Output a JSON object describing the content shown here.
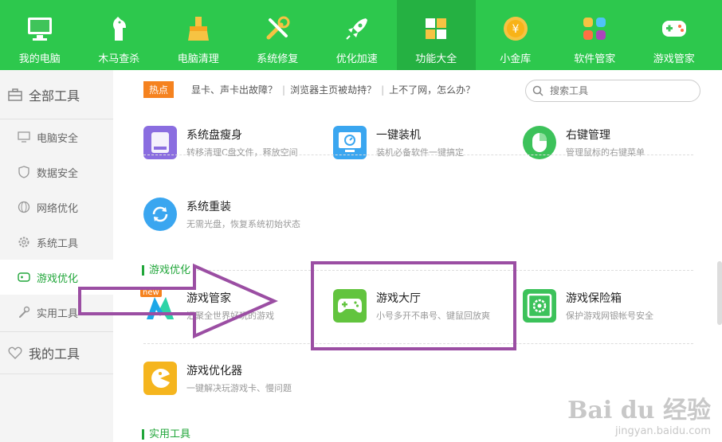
{
  "nav": {
    "items": [
      {
        "label": "我的电脑",
        "icon": "monitor-icon"
      },
      {
        "label": "木马查杀",
        "icon": "trojan-horse-icon"
      },
      {
        "label": "电脑清理",
        "icon": "broom-icon"
      },
      {
        "label": "系统修复",
        "icon": "wrench-icon"
      },
      {
        "label": "优化加速",
        "icon": "rocket-icon"
      },
      {
        "label": "功能大全",
        "icon": "grid-icon",
        "active": true
      },
      {
        "label": "小金库",
        "icon": "coin-icon"
      },
      {
        "label": "软件管家",
        "icon": "apps-icon"
      },
      {
        "label": "游戏管家",
        "icon": "gamepad-icon"
      }
    ]
  },
  "sidebar": {
    "all_tools": "全部工具",
    "items": [
      {
        "label": "电脑安全",
        "icon": "pc-icon"
      },
      {
        "label": "数据安全",
        "icon": "shield-icon"
      },
      {
        "label": "网络优化",
        "icon": "globe-icon"
      },
      {
        "label": "系统工具",
        "icon": "gear-icon"
      },
      {
        "label": "游戏优化",
        "icon": "gamepad-icon",
        "active": true
      },
      {
        "label": "实用工具",
        "icon": "wrench-icon"
      }
    ],
    "my_tools": "我的工具"
  },
  "hotbar": {
    "badge": "热点",
    "links": [
      "显卡、声卡出故障？",
      "浏览器主页被劫持？",
      "上不了网，怎么办？"
    ],
    "separator": "|"
  },
  "search": {
    "placeholder": "搜索工具"
  },
  "tools": {
    "disk_slim": {
      "name": "系统盘瘦身",
      "desc": "转移清理C盘文件，释放空间"
    },
    "one_key_install": {
      "name": "一键装机",
      "desc": "装机必备软件一键搞定"
    },
    "right_click": {
      "name": "右键管理",
      "desc": "管理鼠标的右键菜单"
    },
    "reinstall": {
      "name": "系统重装",
      "desc": "无需光盘，恢复系统初始状态"
    },
    "game_manager": {
      "name": "游戏管家",
      "desc": "汇聚全世界好玩的游戏",
      "badge": "new"
    },
    "game_hall": {
      "name": "游戏大厅",
      "desc": "小号多开不串号、键鼠回放爽"
    },
    "game_safe": {
      "name": "游戏保险箱",
      "desc": "保护游戏网银帐号安全"
    },
    "game_optimizer": {
      "name": "游戏优化器",
      "desc": "一键解决玩游戏卡、慢问题"
    }
  },
  "sections": {
    "game_opt": "游戏优化",
    "utility": "实用工具"
  },
  "watermark": {
    "logo": "Bai du 经验",
    "url": "jingyan.baidu.com"
  },
  "colors": {
    "nav_green": "#2dc84d",
    "accent_green": "#21a63a",
    "annotation_purple": "#9b4ea3",
    "hot_orange": "#f5821f"
  }
}
